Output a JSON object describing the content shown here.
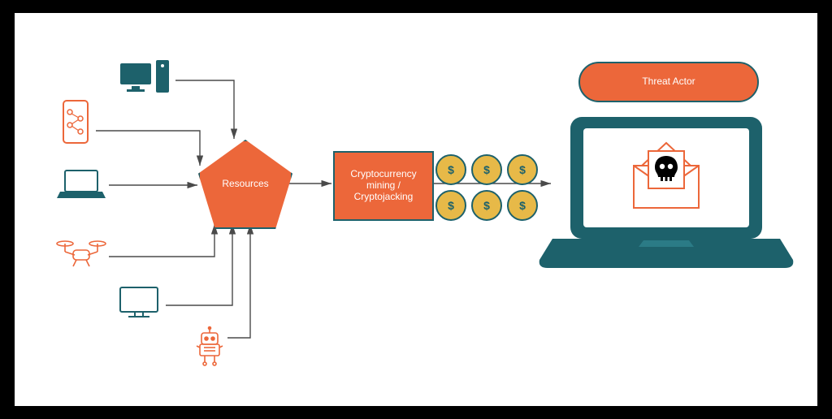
{
  "nodes": {
    "resources_label": "Resources",
    "mining_label": "Cryptocurrency mining / Cryptojacking",
    "threat_actor_label": "Threat Actor"
  },
  "coins": {
    "symbol": "$"
  },
  "colors": {
    "accent_orange": "#ec673a",
    "teal": "#1d616b",
    "coin": "#e7b948",
    "arrow": "#4a4a4a"
  },
  "device_inputs": [
    "desktop-computer",
    "smartphone",
    "laptop",
    "drone",
    "monitor",
    "robot"
  ],
  "flow": [
    "devices -> resources",
    "resources -> cryptocurrency-mining",
    "cryptocurrency-mining -> coins -> threat-actor-laptop"
  ]
}
